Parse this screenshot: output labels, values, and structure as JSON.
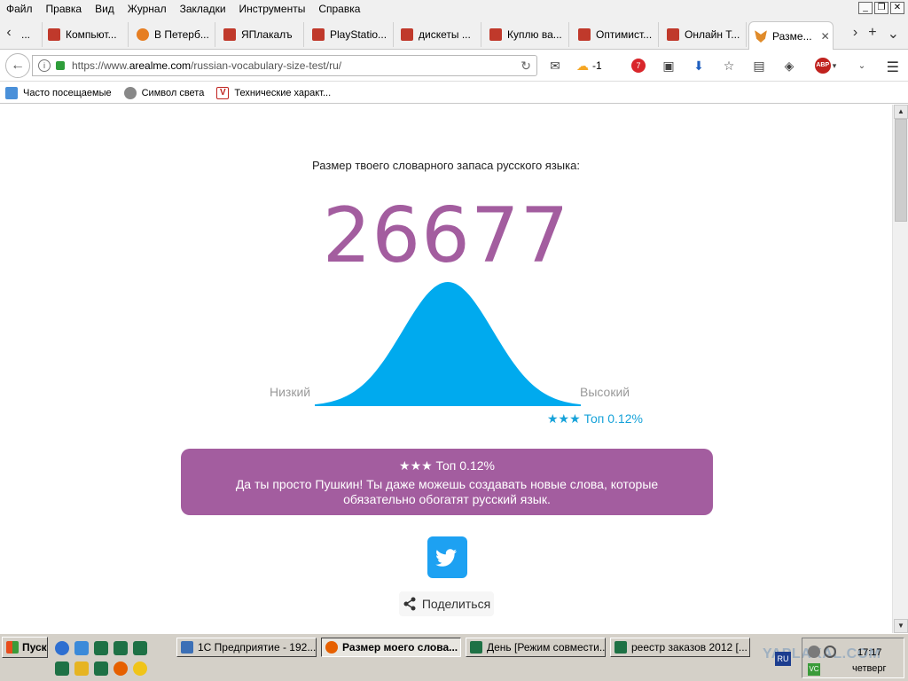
{
  "menu": [
    "Файл",
    "Правка",
    "Вид",
    "Журнал",
    "Закладки",
    "Инструменты",
    "Справка"
  ],
  "tabs": [
    {
      "label": "...",
      "color": "#d14836"
    },
    {
      "label": "Компьют...",
      "color": "#c0392b"
    },
    {
      "label": "В Петерб...",
      "color": "#e67e22"
    },
    {
      "label": "ЯПлакалъ",
      "color": "#c0392b"
    },
    {
      "label": "PlayStatio...",
      "color": "#c0392b"
    },
    {
      "label": "дискеты ...",
      "color": "#c0392b"
    },
    {
      "label": "Куплю ва...",
      "color": "#c0392b"
    },
    {
      "label": "Оптимист...",
      "color": "#c0392b"
    },
    {
      "label": "Онлайн Т...",
      "color": "#c0392b"
    },
    {
      "label": "Разме...",
      "color": "#e08b2a",
      "active": true
    }
  ],
  "nav": {
    "url_prefix": "https://www.",
    "url_domain": "arealme.com",
    "url_path": "/russian-vocabulary-size-test/ru/",
    "weather": "-1",
    "mail_badge": "7",
    "abp": "ABP"
  },
  "bookmarks": [
    "Часто посещаемые",
    "Символ света",
    "Технические характ..."
  ],
  "page": {
    "subtitle": "Размер твоего словарного запаса русского языка:",
    "score": "26677",
    "low_label": "Низкий",
    "high_label": "Высокий",
    "rank_small": "★★★ Топ 0.12%",
    "result_title": "★★★ Топ 0.12%",
    "result_text": "Да ты просто Пушкин! Ты даже можешь создавать новые слова, которые обязательно обогатят русский язык.",
    "share": "Поделиться",
    "curve_color": "#00aaee",
    "score_color": "#a35d9f"
  },
  "taskbar": {
    "start": "Пуск",
    "items": [
      {
        "label": "1С Предприятие - 192....",
        "color": "#3b6fb6"
      },
      {
        "label": "Размер моего слова...",
        "color": "#e66000",
        "active": true
      },
      {
        "label": "День  [Режим совмести...",
        "color": "#1e7145"
      },
      {
        "label": "реестр заказов 2012  [...",
        "color": "#1e7145"
      }
    ],
    "lang": "RU",
    "time": "17:17",
    "day": "четверг",
    "watermark": "YAPLAKAL.COM"
  }
}
